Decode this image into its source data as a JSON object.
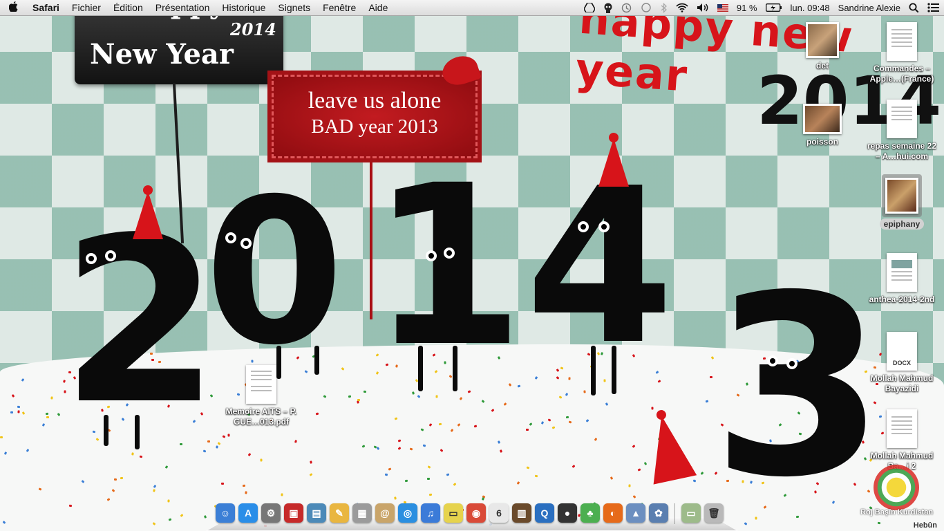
{
  "menubar": {
    "apple": "",
    "app_name": "Safari",
    "menus": [
      "Fichier",
      "Édition",
      "Présentation",
      "Historique",
      "Signets",
      "Fenêtre",
      "Aide"
    ],
    "battery": "91 %",
    "clock": "lun. 09:48",
    "user": "Sandrine Alexie",
    "status_icons": [
      "google-drive-icon",
      "alien-icon",
      "time-machine-icon",
      "toggle-icon",
      "bluetooth-icon",
      "wifi-icon",
      "volume-icon",
      "flag-us-icon",
      "battery-icon",
      "spotlight-icon",
      "notification-icon"
    ]
  },
  "wallpaper": {
    "sign_black": {
      "line1": "Happy",
      "line2": "New Year",
      "line3": "2014"
    },
    "sign_red": {
      "line1": "leave us alone",
      "line2": "BAD year 2013"
    },
    "digits": [
      "2",
      "0",
      "1",
      "4",
      "3"
    ],
    "doodle_top": "happy new year",
    "doodle_year": "2014",
    "colors": {
      "accent_red": "#d7141a",
      "tile_green": "#8cb8aa",
      "tile_light": "#dfe9e5"
    }
  },
  "desktop_icons": [
    {
      "label": "det",
      "kind": "photo"
    },
    {
      "label": "Commandes – Apple…(France)",
      "kind": "document"
    },
    {
      "label": "poisson",
      "kind": "photo"
    },
    {
      "label": "repas semaine 22 – A…hui.com",
      "kind": "document"
    },
    {
      "label": "epiphany",
      "kind": "photo",
      "selected": true
    },
    {
      "label": "anthea-2014-2nd",
      "kind": "document"
    },
    {
      "label": "Mollah Mahmud Bayazidi",
      "kind": "docx",
      "tag": "DOCX"
    },
    {
      "label": "Mollah Mahmud Ba…i 2",
      "kind": "document"
    },
    {
      "label": "Memoire AITS – P. GUE…013.pdf",
      "kind": "pdf"
    }
  ],
  "dock": {
    "apps": [
      {
        "name": "finder-icon",
        "glyph": "☺",
        "color": "#3b7fd6"
      },
      {
        "name": "app-store-icon",
        "glyph": "A",
        "color": "#2a8ee8"
      },
      {
        "name": "system-preferences-icon",
        "glyph": "⚙",
        "color": "#777777"
      },
      {
        "name": "photo-booth-icon",
        "glyph": "▣",
        "color": "#c62a2a"
      },
      {
        "name": "preview-icon",
        "glyph": "▤",
        "color": "#4c8ab8"
      },
      {
        "name": "textedit-icon",
        "glyph": "✎",
        "color": "#e9b640"
      },
      {
        "name": "calculator-icon",
        "glyph": "▦",
        "color": "#9b9b9b"
      },
      {
        "name": "contacts-icon",
        "glyph": "@",
        "color": "#c9a56a"
      },
      {
        "name": "safari-icon",
        "glyph": "◎",
        "color": "#2b8fe0"
      },
      {
        "name": "itunes-icon",
        "glyph": "♫",
        "color": "#3b7bd8"
      },
      {
        "name": "stickies-icon",
        "glyph": "▭",
        "color": "#e6d34d"
      },
      {
        "name": "chrome-icon",
        "glyph": "◉",
        "color": "#d94a38"
      },
      {
        "name": "calendar-icon",
        "glyph": "6",
        "color": "#e8e8e8"
      },
      {
        "name": "ibooks-icon",
        "glyph": "▥",
        "color": "#6a4a2b"
      },
      {
        "name": "quicktime-icon",
        "glyph": "Q",
        "color": "#2a6fc0"
      },
      {
        "name": "webcam-icon",
        "glyph": "●",
        "color": "#333333"
      },
      {
        "name": "adium-icon",
        "glyph": "♣",
        "color": "#4caf50"
      },
      {
        "name": "firefox-icon",
        "glyph": "◐",
        "color": "#e66a1a"
      },
      {
        "name": "image-capture-icon",
        "glyph": "▲",
        "color": "#6c8fc0"
      },
      {
        "name": "iphoto-icon",
        "glyph": "✿",
        "color": "#5a7fb0"
      }
    ],
    "stacks": [
      {
        "name": "downloads-stack-icon",
        "glyph": "▭",
        "color": "#9dbb8a"
      },
      {
        "name": "trash-icon",
        "glyph": "🗑",
        "color": "#b9b9b9"
      }
    ]
  },
  "watermark": "Roj Başîn Kurdistan",
  "corner_mark": "Hebûn"
}
